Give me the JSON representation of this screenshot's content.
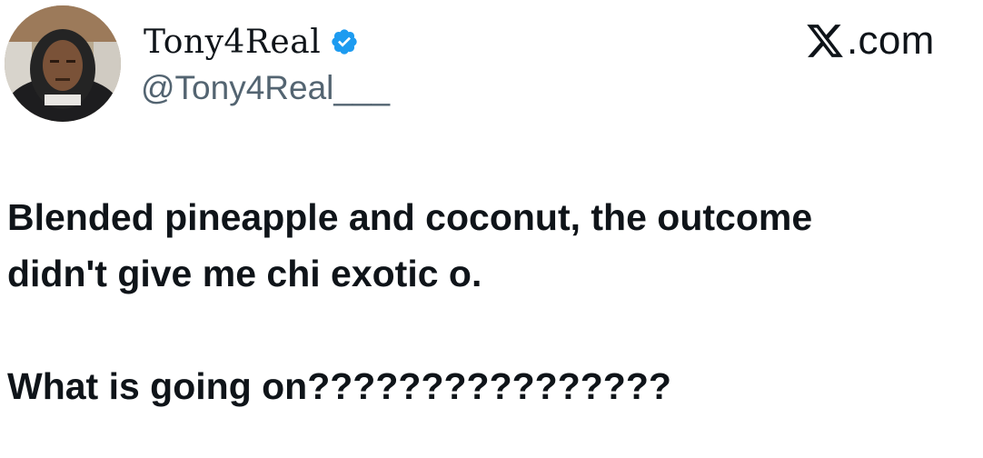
{
  "post": {
    "author": {
      "display_name": "Tony4Real",
      "handle": "@Tony4Real___",
      "verified": true,
      "verified_color": "#1d9bf0"
    },
    "brand": {
      "icon": "x-logo-icon",
      "text": ".com"
    },
    "text": {
      "line1": "Blended pineapple and coconut, the outcome",
      "line2": "didn't give me chi exotic o.",
      "line3": "What is going on????????????????"
    }
  },
  "colors": {
    "text_primary": "#0f1419",
    "text_secondary": "#536471",
    "background": "#ffffff"
  }
}
